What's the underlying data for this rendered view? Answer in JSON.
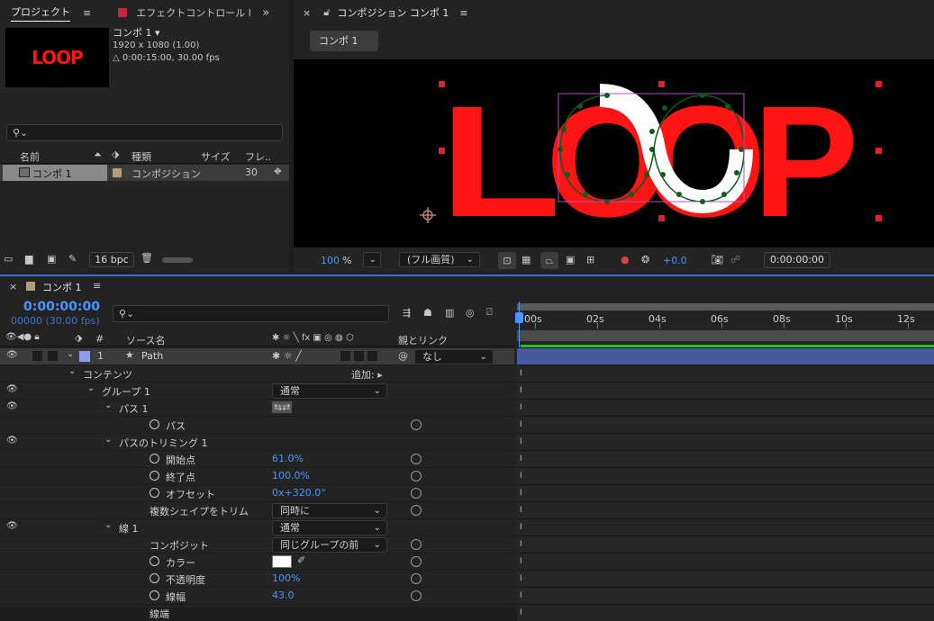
{
  "project": {
    "tab": "プロジェクト",
    "menu": "≡",
    "comp_name": "コンポ 1 ▾",
    "comp_dims": "1920 x 1080 (1.00)",
    "comp_dur": "△ 0:00:15:00, 30.00 fps",
    "thumb_text": "LOOP",
    "search_placeholder": "",
    "col_name": "名前",
    "col_type": "種類",
    "col_size": "サイズ",
    "col_frame": "フレ..",
    "row_name": "コンポ 1",
    "row_type": "コンポジション",
    "row_fps": "30",
    "bpc": "16 bpc"
  },
  "effects": {
    "tab": "エフェクトコントロール l",
    "more": "»"
  },
  "viewer": {
    "tab": "コンポジション コンポ 1",
    "menu": "≡",
    "subtab": "コンポ 1",
    "art_text": "LOOP",
    "zoom": "100",
    "zoom_unit": "%",
    "quality": "(フル画質)",
    "exposure": "+0.0",
    "time": "0:00:00:00"
  },
  "timeline": {
    "tab": "コンポ 1",
    "menu": "≡",
    "timecode": "0:00:00:00",
    "frames": "00000 (30.00 fps)",
    "col_source": "ソース名",
    "col_parent": "親とリンク",
    "col_switches": "✱ ☼ ╲ fx ▣ ◎ ◍ ⬡",
    "ruler": [
      "00s",
      "02s",
      "04s",
      "06s",
      "08s",
      "10s",
      "12s"
    ],
    "accent": "#4c96ff"
  },
  "layers": [
    {
      "name": "Path",
      "num": "1",
      "parent": "なし",
      "switch": "✱ ☼ ╱"
    },
    {
      "name": "コンテンツ",
      "add": "追加:"
    },
    {
      "name": "グループ 1",
      "mode": "通常"
    },
    {
      "name": "パス 1"
    },
    {
      "name": "パス"
    },
    {
      "name": "パスのトリミング 1"
    },
    {
      "name": "開始点",
      "value": "61.0%"
    },
    {
      "name": "終了点",
      "value": "100.0%"
    },
    {
      "name": "オフセット",
      "value": "0x+320.0°"
    },
    {
      "name": "複数シェイプをトリム",
      "mode": "同時に"
    },
    {
      "name": "線 1",
      "mode": "通常"
    },
    {
      "name": "コンポジット",
      "mode": "同じグループの前"
    },
    {
      "name": "カラー",
      "color": "#ffffff"
    },
    {
      "name": "不透明度",
      "value": "100%"
    },
    {
      "name": "線幅",
      "value": "43.0"
    },
    {
      "name": "線端"
    }
  ]
}
